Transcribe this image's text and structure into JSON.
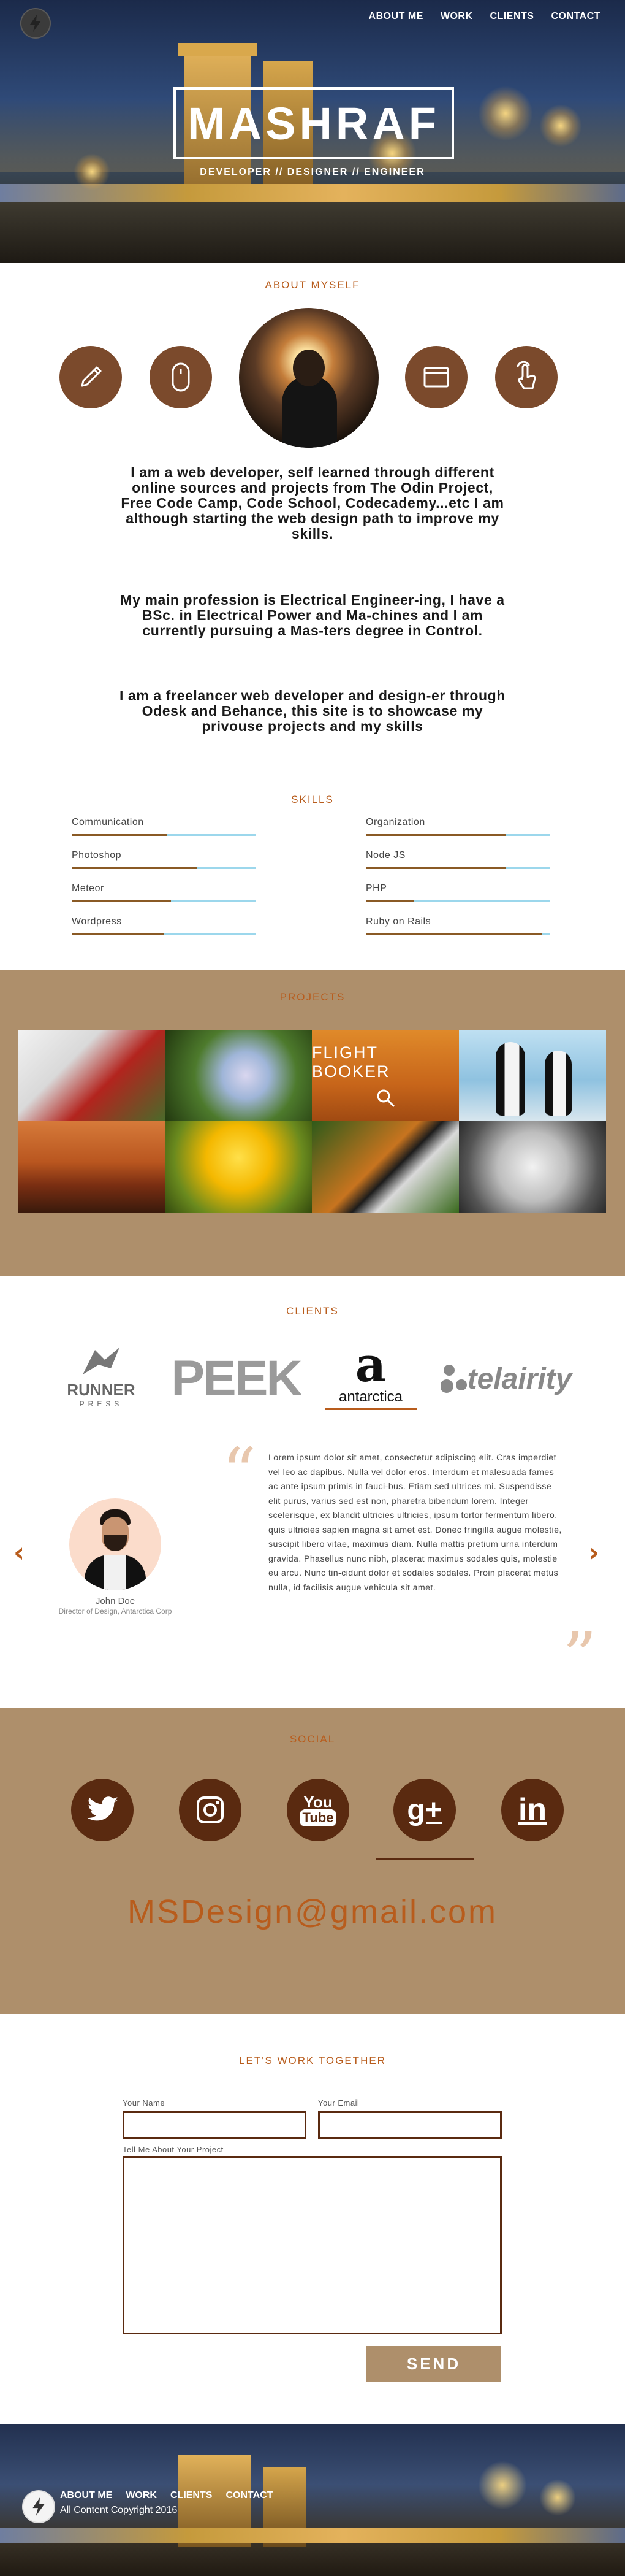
{
  "nav": {
    "items": [
      "ABOUT ME",
      "WORK",
      "CLIENTS",
      "CONTACT"
    ]
  },
  "hero": {
    "title": "MASHRAF",
    "tagline": "DEVELOPER // DESIGNER // ENGINEER"
  },
  "about": {
    "title": "ABOUT MYSELF",
    "icons": [
      "pencil-icon",
      "mouse-icon",
      "browser-window-icon",
      "touch-gesture-icon"
    ],
    "paragraphs": [
      "I am a web developer, self learned through different online sources and projects from The Odin Project, Free Code Camp, Code School, Codecademy...etc I am although starting the web design path to improve my skills.",
      "My main profession is Electrical Engineer-ing, I have a BSc. in Electrical Power and Ma-chines and I am currently pursuing a Mas-ters degree in Control.",
      "I am a freelancer web developer and design-er through Odesk and Behance, this site is to showcase my privouse projects and  my skills"
    ]
  },
  "skills": {
    "title": "SKILLS",
    "left": [
      {
        "name": "Communication",
        "level": 0.52
      },
      {
        "name": "Photoshop",
        "level": 0.68
      },
      {
        "name": "Meteor",
        "level": 0.54
      },
      {
        "name": "Wordpress",
        "level": 0.5
      }
    ],
    "right": [
      {
        "name": "Organization",
        "level": 0.76
      },
      {
        "name": "Node JS",
        "level": 0.76
      },
      {
        "name": "PHP",
        "level": 0.26
      },
      {
        "name": "Ruby on Rails",
        "level": 0.96
      }
    ]
  },
  "projects": {
    "title": "PROJECTS",
    "flight_label": "FLIGHT BOOKER",
    "tiles": [
      "snowman-photo",
      "hydrangea-photo",
      "flight-booker-project",
      "penguins-photo",
      "desert-photo",
      "tulips-photo",
      "tiger-photo",
      "wolf-photo"
    ]
  },
  "clients": {
    "title": "CLIENTS",
    "logos": {
      "runner": "RUNNER",
      "runner_sub": "PRESS",
      "peek": "PEEK",
      "antarctica_mark": "a",
      "antarctica": "antarctica",
      "telairity": "telairity"
    },
    "testimonial": "Lorem ipsum dolor sit amet, consectetur adipiscing elit. Cras imperdiet vel leo ac dapibus. Nulla vel dolor eros. Interdum et malesuada fames ac ante ipsum primis in fauci-bus. Etiam sed ultrices mi. Suspendisse elit purus, varius sed est non, pharetra bibendum lorem. Integer scelerisque, ex blandit ultricies ultricies, ipsum tortor fermentum libero, quis ultricies sapien magna sit amet est. Donec fringilla augue molestie, suscipit libero vitae, maximus diam. Nulla mattis pretium urna interdum gravida. Phasellus nunc nibh, placerat maximus sodales quis, molestie eu arcu. Nunc tin-cidunt dolor et sodales sodales. Proin placerat metus nulla, id facilisis augue vehicula sit amet.",
    "person_name": "John Doe",
    "person_role": "Director of Design, Antarctica Corp",
    "prev": "‹",
    "next": "›",
    "quote_open": "“",
    "quote_close": "”"
  },
  "social": {
    "title": "SOCIAL",
    "icons": [
      "twitter-icon",
      "instagram-icon",
      "youtube-icon",
      "google-plus-icon",
      "linkedin-icon"
    ],
    "youtube_top": "You",
    "youtube_bottom": "Tube",
    "gplus": "g+",
    "linkedin": "in",
    "email": "MSDesign@gmail.com"
  },
  "contact": {
    "title": "LET'S WORK TOGETHER",
    "name_label": "Your Name",
    "email_label": "Your Email",
    "project_label": "Tell Me About Your Project",
    "send": "SEND"
  },
  "footer": {
    "nav": [
      "ABOUT ME",
      "WORK",
      "CLIENTS",
      "CONTACT"
    ],
    "copyright": "All Content Copyright 2016"
  },
  "colors": {
    "accent": "#b85c1c",
    "brown": "#7b4a2c",
    "dark_brown": "#5a2a10",
    "tan": "#ae8f6b",
    "skill_track": "#9cd7ec"
  }
}
